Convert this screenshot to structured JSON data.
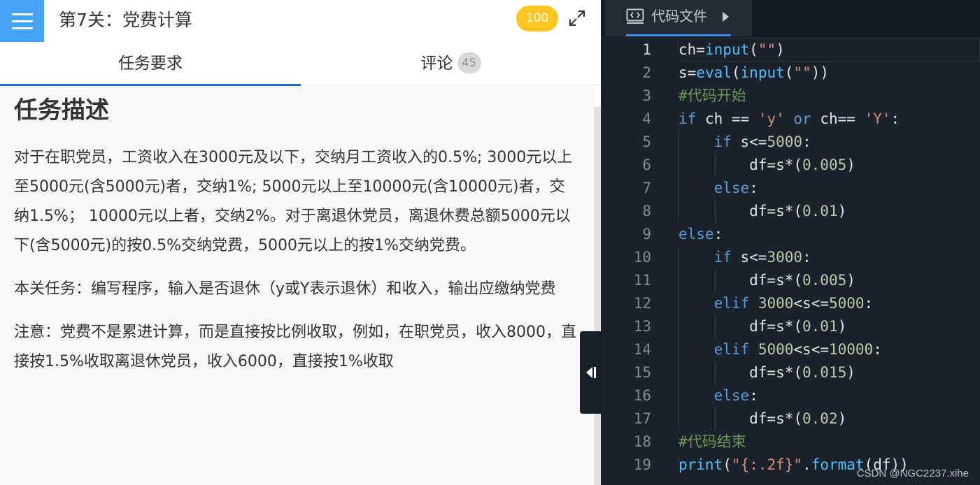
{
  "header": {
    "title": "第7关：党费计算",
    "score": "100"
  },
  "tabs": {
    "task": "任务要求",
    "comment": "评论",
    "comment_count": "45"
  },
  "task": {
    "heading": "任务描述",
    "paragraphs": [
      "对于在职党员，工资收入在3000元及以下，交纳月工资收入的0.5%; 3000元以上至5000元(含5000元)者，交纳1%; 5000元以上至10000元(含10000元)者，交纳1.5%； 10000元以上者，交纳2%。对于离退休党员，离退休费总额5000元以下(含5000元)的按0.5%交纳党费，5000元以上的按1%交纳党费。",
      "本关任务：编写程序，输入是否退休（y或Y表示退休）和收入，输出应缴纳党费",
      "注意：党费不是累进计算，而是直接按比例收取，例如，在职党员，收入8000，直接按1.5%收取离退休党员，收入6000，直接按1%收取"
    ]
  },
  "editor": {
    "tab_label": "代码文件",
    "lines": [
      "ch=input(\"\")",
      "s=eval(input(\"\"))",
      "#代码开始",
      "if ch == 'y' or ch== 'Y':",
      "    if s<=5000:",
      "        df=s*(0.005)",
      "    else:",
      "        df=s*(0.01)",
      "else:",
      "    if s<=3000:",
      "        df=s*(0.005)",
      "    elif 3000<s<=5000:",
      "        df=s*(0.01)",
      "    elif 5000<s<=10000:",
      "        df=s*(0.015)",
      "    else:",
      "        df=s*(0.02)",
      "#代码结束",
      "print(\"{:.2f}\".format(df))"
    ],
    "line_numbers": [
      "1",
      "2",
      "3",
      "4",
      "5",
      "6",
      "7",
      "8",
      "9",
      "10",
      "11",
      "12",
      "13",
      "14",
      "15",
      "16",
      "17",
      "18",
      "19"
    ]
  },
  "watermark": "CSDN @NGC2237.xihe",
  "colors": {
    "menu_blue": "#45a3f5",
    "score_yellow": "#fcc51f",
    "tab_underline": "#1c6ed2",
    "editor_bg": "#1b222c"
  }
}
